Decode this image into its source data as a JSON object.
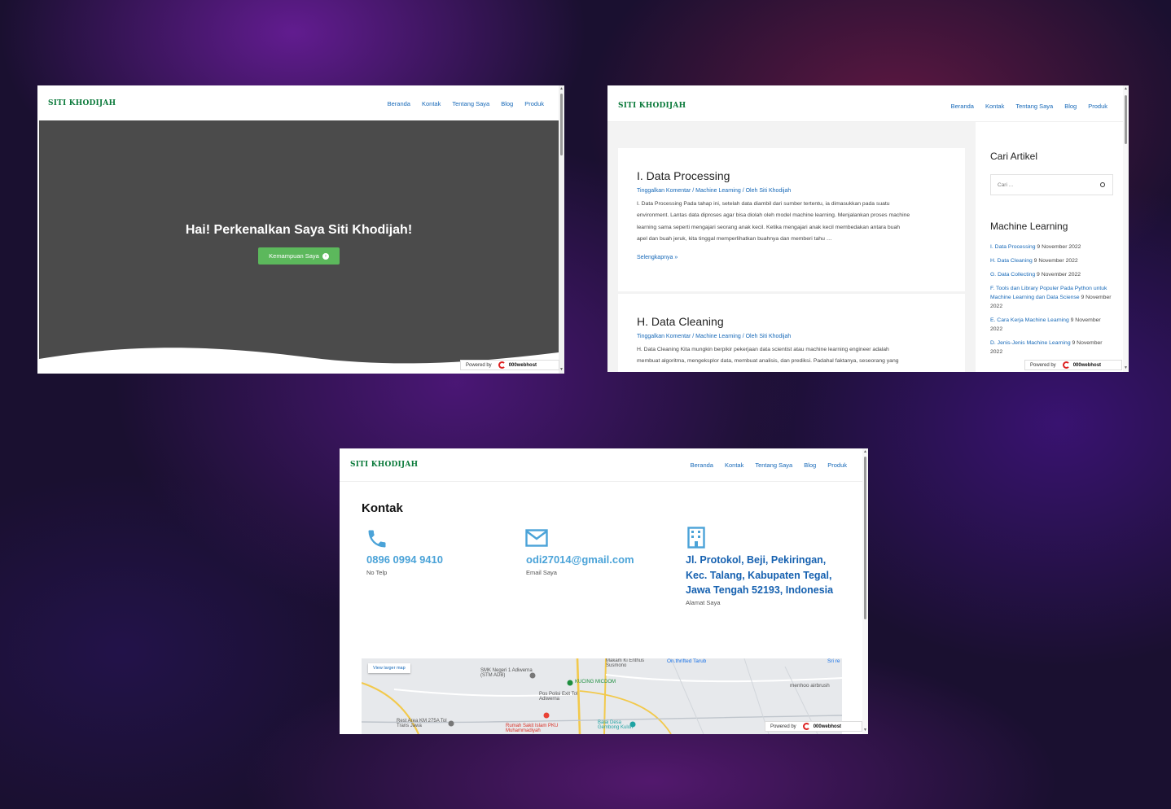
{
  "site": {
    "logo": "SITI KHODIJAH",
    "nav": [
      "Beranda",
      "Kontak",
      "Tentang Saya",
      "Blog",
      "Produk"
    ]
  },
  "powered": {
    "label": "Powered by",
    "brand": "000webhost"
  },
  "home": {
    "headline": "Hai! Perkenalkan Saya Siti Khodijah!",
    "button": "Kemampuan Saya"
  },
  "blog": {
    "posts": [
      {
        "title": "I. Data Processing",
        "meta": "Tinggalkan Komentar / Machine Learning / Oleh Siti Khodijah",
        "lines": [
          "I. Data Processing Pada tahap ini, setelah data diambil dari sumber tertentu, ia dimasukkan pada suatu",
          "environment. Lantas data diproses agar bisa diolah oleh model machine learning. Menjalankan proses machine",
          "learning sama seperti mengajari seorang anak kecil. Ketika mengajari anak kecil membedakan antara buah",
          "apel dan buah jeruk, kita tinggal memperlihatkan buahnya dan memberi tahu …"
        ],
        "more": "Selengkapnya »"
      },
      {
        "title": "H. Data Cleaning",
        "meta": "Tinggalkan Komentar / Machine Learning / Oleh Siti Khodijah",
        "lines": [
          "H. Data Cleaning Kita mungkin berpikir pekerjaan data scientist atau machine learning engineer adalah",
          "membuat algoritma, mengeksplor data, membuat analisis, dan prediksi. Padahal faktanya, seseorang yang"
        ]
      }
    ],
    "sidebar": {
      "search_title": "Cari Artikel",
      "search_placeholder": "Cari ...",
      "section_title": "Machine Learning",
      "items": [
        {
          "link": "I. Data Processing",
          "date": " 9 November 2022"
        },
        {
          "link": "H. Data Cleaning",
          "date": " 9 November 2022"
        },
        {
          "link": "G. Data Collecting",
          "date": " 9 November 2022"
        },
        {
          "link": "F. Tools dan Library Populer Pada Python untuk Machine Learning dan Data Sciense",
          "date": " 9 November 2022"
        },
        {
          "link": "E. Cara Kerja Machine Learning",
          "date": " 9 November 2022"
        },
        {
          "link": "D. Jenis-Jenis Machine Learning",
          "date": " 9 November 2022"
        }
      ]
    }
  },
  "contact": {
    "title": "Kontak",
    "phone": {
      "value": "0896 0994 9410",
      "label": "No Telp"
    },
    "email": {
      "value": "odi27014@gmail.com",
      "label": "Email Saya"
    },
    "address": {
      "value": "Jl. Protokol, Beji, Pekiringan, Kec. Talang, Kabupaten Tegal, Jawa Tengah 52193, Indonesia",
      "label": "Alamat Saya"
    },
    "map": {
      "button": "View larger map",
      "labels": [
        "SMK Negeri 1 Adiwerna (STM ADB)",
        "Makam Ki Enthus Susmono",
        "On.thrifted Tarub",
        "KUCING MICDOM",
        "Pos Polisi Exit Tol Adiwerna",
        "menhoo airbrush",
        "Rest Area KM 275A Tol Trans Jawa",
        "Rumah Sakit Islam PKU Muhammadiyah",
        "Balai Desa Gembong Kulon",
        "Sri re"
      ]
    }
  },
  "colors": {
    "brand_green": "#0b7a3b",
    "link_blue": "#1769b8",
    "hero_grey": "#4b4b4b",
    "button_green": "#5cb85c",
    "accent_blue": "#4ba3d8"
  }
}
